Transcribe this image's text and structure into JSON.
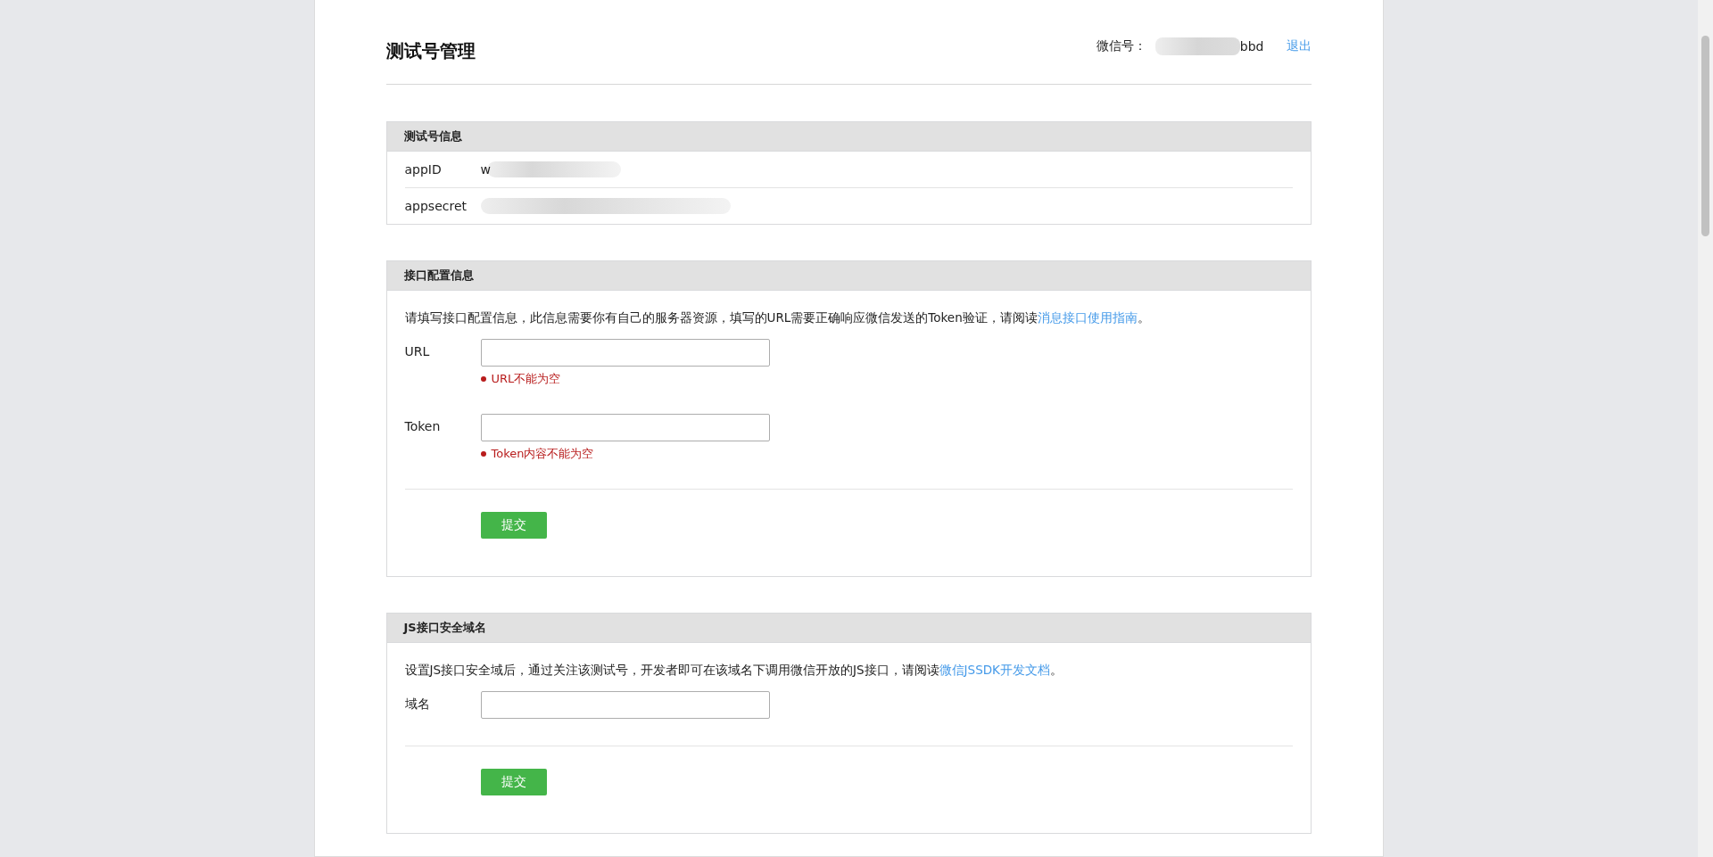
{
  "header": {
    "title": "测试号管理",
    "account_label": "微信号：",
    "account_value": "bbd",
    "logout": "退出"
  },
  "panels": [
    {
      "kind": "info",
      "title": "测试号信息",
      "rows": [
        {
          "label": "appID",
          "value": "w"
        },
        {
          "label": "appsecret"
        }
      ]
    },
    {
      "kind": "form",
      "title": "接口配置信息",
      "description": "请填写接口配置信息，此信息需要你有自己的服务器资源，填写的URL需要正确响应微信发送的Token验证，请阅读",
      "link": "消息接口使用指南",
      "description_end": "。",
      "fields": [
        {
          "label": "URL",
          "error": "URL不能为空"
        },
        {
          "label": "Token",
          "error": "Token内容不能为空"
        }
      ],
      "submit": "提交"
    },
    {
      "kind": "form",
      "title": "JS接口安全域名",
      "description": "设置JS接口安全域后，通过关注该测试号，开发者即可在该域名下调用微信开放的JS接口，请阅读",
      "link": "微信JSSDK开发文档",
      "description_end": "。",
      "fields": [
        {
          "label": "域名"
        }
      ],
      "submit": "提交"
    }
  ]
}
